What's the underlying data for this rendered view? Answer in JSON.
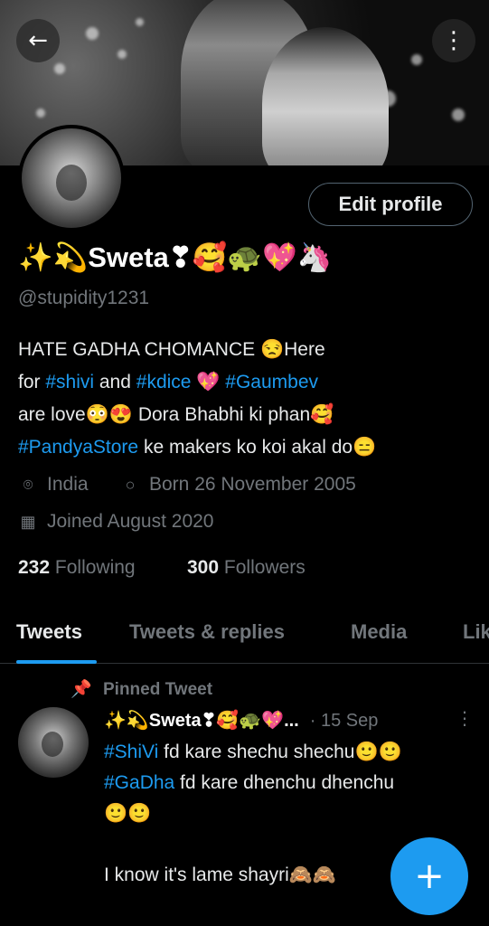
{
  "header": {
    "back_icon": "arrow-left-icon",
    "more_icon": "more-vertical-icon"
  },
  "profile": {
    "display_name": "✨💫Sweta❣🥰🐢💖🦄",
    "handle": "@stupidity1231",
    "edit_profile_label": "Edit profile",
    "bio": {
      "line1": {
        "a": "HATE GADHA CHOMANCE 😒Here"
      },
      "line2": {
        "a": "for ",
        "b": "#shivi",
        "c": " and ",
        "d": "#kdice",
        "e": " 💖 ",
        "f": "#Gaumbev"
      },
      "line3": {
        "a": "are love😳😍 Dora Bhabhi ki phan🥰"
      },
      "line4": {
        "a": "#PandyaStore",
        "b": " ke makers ko koi akal do😑"
      }
    },
    "location": "India",
    "born": "Born 26 November 2005",
    "joined": "Joined August 2020",
    "following_count": "232",
    "following_label": "Following",
    "followers_count": "300",
    "followers_label": "Followers"
  },
  "tabs": [
    "Tweets",
    "Tweets & replies",
    "Media",
    "Likes"
  ],
  "active_tab": "Tweets",
  "pinned_tweet": {
    "pinned_label": "Pinned Tweet",
    "author_name": "✨💫Sweta❣🥰🐢💖...",
    "time": "· 15 Sep",
    "line1": {
      "a": "#ShiVi",
      "b": " fd kare shechu shechu🙂🙂"
    },
    "line2": {
      "a": "#GaDha",
      "b": " fd kare dhenchu dhenchu"
    },
    "line3": "🙂🙂",
    "line4": "",
    "line5": "I know it's lame shayri🙈🙈"
  },
  "fab": {
    "icon": "compose-plus-icon",
    "label": "+"
  },
  "colors": {
    "accent": "#1d9bf0",
    "muted": "#71767b",
    "text": "#e7e9ea",
    "background": "#000000"
  }
}
